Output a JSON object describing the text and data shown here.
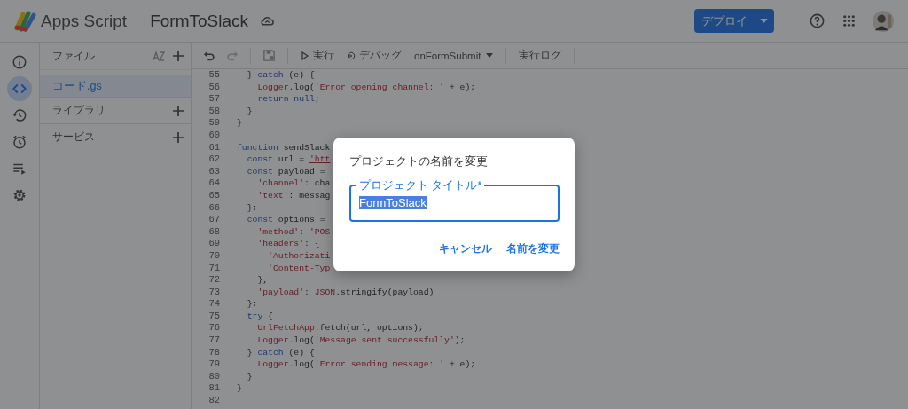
{
  "app": {
    "product": "Apps Script",
    "project": "FormToSlack",
    "deploy": "デプロイ"
  },
  "rail": [
    {
      "kind": "info",
      "selected": false
    },
    {
      "kind": "code",
      "selected": true
    },
    {
      "kind": "history",
      "selected": false
    },
    {
      "kind": "alarm",
      "selected": false
    },
    {
      "kind": "executions",
      "selected": false
    },
    {
      "kind": "settings",
      "selected": false
    }
  ],
  "files": {
    "title": "ファイル",
    "items": [
      {
        "label": "コード.gs",
        "selected": true
      }
    ],
    "sections": [
      "ライブラリ",
      "サービス"
    ]
  },
  "toolbar": {
    "run": "実行",
    "debug": "デバッグ",
    "function": "onFormSubmit",
    "log": "実行ログ"
  },
  "editor": {
    "lines": [
      {
        "n": "55",
        "tokens": [
          {
            "text": "  } ",
            "kind": "p"
          },
          {
            "text": "catch",
            "kind": "kw"
          },
          {
            "text": " (e) {",
            "kind": "p"
          }
        ]
      },
      {
        "n": "56",
        "tokens": [
          {
            "text": "    Logger",
            "kind": "obj"
          },
          {
            "text": ".log(",
            "kind": "p"
          },
          {
            "text": "'Error opening channel: '",
            "kind": "str"
          },
          {
            "text": " + e);",
            "kind": "p"
          }
        ]
      },
      {
        "n": "57",
        "tokens": [
          {
            "text": "    return null",
            "kind": "kw"
          },
          {
            "text": ";",
            "kind": "p"
          }
        ]
      },
      {
        "n": "58",
        "tokens": [
          {
            "text": "  }",
            "kind": "p"
          }
        ]
      },
      {
        "n": "59",
        "tokens": [
          {
            "text": "}",
            "kind": "p"
          }
        ]
      },
      {
        "n": "60"
      },
      {
        "n": "61",
        "tokens": [
          {
            "text": "function",
            "kind": "kw"
          },
          {
            "text": " sendSlack",
            "kind": "p"
          }
        ]
      },
      {
        "n": "62",
        "tokens": [
          {
            "text": "  const",
            "kind": "kw"
          },
          {
            "text": " url = ",
            "kind": "p"
          },
          {
            "text": "'htt",
            "kind": "url"
          }
        ]
      },
      {
        "n": "63",
        "tokens": [
          {
            "text": "  const",
            "kind": "kw"
          },
          {
            "text": " payload =",
            "kind": "p"
          }
        ]
      },
      {
        "n": "64",
        "tokens": [
          {
            "text": "    'channel'",
            "kind": "str"
          },
          {
            "text": ": cha",
            "kind": "p"
          }
        ]
      },
      {
        "n": "65",
        "tokens": [
          {
            "text": "    'text'",
            "kind": "str"
          },
          {
            "text": ": messag",
            "kind": "p"
          }
        ]
      },
      {
        "n": "66",
        "tokens": [
          {
            "text": "  };",
            "kind": "p"
          }
        ]
      },
      {
        "n": "67",
        "tokens": [
          {
            "text": "  const",
            "kind": "kw"
          },
          {
            "text": " options =",
            "kind": "p"
          }
        ]
      },
      {
        "n": "68",
        "tokens": [
          {
            "text": "    'method'",
            "kind": "str"
          },
          {
            "text": ": ",
            "kind": "p"
          },
          {
            "text": "'POS",
            "kind": "str"
          }
        ]
      },
      {
        "n": "69",
        "tokens": [
          {
            "text": "    'headers'",
            "kind": "str"
          },
          {
            "text": ": {",
            "kind": "p"
          }
        ]
      },
      {
        "n": "70",
        "tokens": [
          {
            "text": "      'Authorizati",
            "kind": "str"
          }
        ]
      },
      {
        "n": "71",
        "tokens": [
          {
            "text": "      'Content-Typ",
            "kind": "str"
          }
        ]
      },
      {
        "n": "72",
        "tokens": [
          {
            "text": "    },",
            "kind": "p"
          }
        ]
      },
      {
        "n": "73",
        "tokens": [
          {
            "text": "    'payload'",
            "kind": "str"
          },
          {
            "text": ": ",
            "kind": "p"
          },
          {
            "text": "JSON",
            "kind": "obj"
          },
          {
            "text": ".stringify(payload)",
            "kind": "p"
          }
        ]
      },
      {
        "n": "74",
        "tokens": [
          {
            "text": "  };",
            "kind": "p"
          }
        ]
      },
      {
        "n": "75",
        "tokens": [
          {
            "text": "  try",
            "kind": "kw"
          },
          {
            "text": " {",
            "kind": "p"
          }
        ]
      },
      {
        "n": "76",
        "tokens": [
          {
            "text": "    UrlFetchApp",
            "kind": "obj"
          },
          {
            "text": ".fetch(url, options);",
            "kind": "p"
          }
        ]
      },
      {
        "n": "77",
        "tokens": [
          {
            "text": "    Logger",
            "kind": "obj"
          },
          {
            "text": ".log(",
            "kind": "p"
          },
          {
            "text": "'Message sent successfully'",
            "kind": "str"
          },
          {
            "text": ");",
            "kind": "p"
          }
        ]
      },
      {
        "n": "78",
        "tokens": [
          {
            "text": "  } ",
            "kind": "p"
          },
          {
            "text": "catch",
            "kind": "kw"
          },
          {
            "text": " (e) {",
            "kind": "p"
          }
        ]
      },
      {
        "n": "79",
        "tokens": [
          {
            "text": "    Logger",
            "kind": "obj"
          },
          {
            "text": ".log(",
            "kind": "p"
          },
          {
            "text": "'Error sending message: '",
            "kind": "str"
          },
          {
            "text": " + e);",
            "kind": "p"
          }
        ]
      },
      {
        "n": "80",
        "tokens": [
          {
            "text": "  }",
            "kind": "p"
          }
        ]
      },
      {
        "n": "81",
        "tokens": [
          {
            "text": "}",
            "kind": "p"
          }
        ]
      },
      {
        "n": "82"
      }
    ]
  },
  "dialog": {
    "title": "プロジェクトの名前を変更",
    "field": {
      "label": "プロジェクト タイトル*",
      "value": "FormToSlack",
      "selected": true
    },
    "buttons": [
      "キャンセル",
      "名前を変更"
    ]
  }
}
